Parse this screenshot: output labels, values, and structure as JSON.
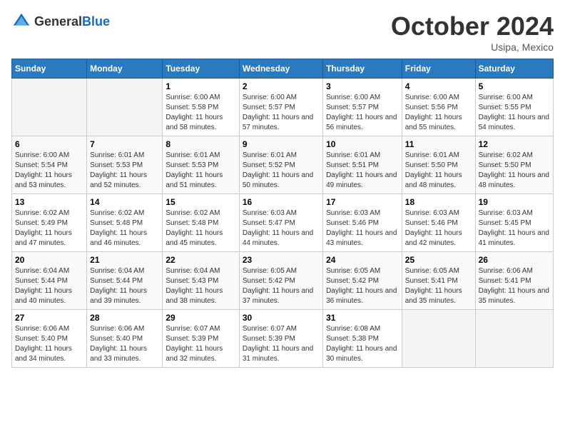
{
  "header": {
    "logo_general": "General",
    "logo_blue": "Blue",
    "month_title": "October 2024",
    "location": "Usipa, Mexico"
  },
  "days_of_week": [
    "Sunday",
    "Monday",
    "Tuesday",
    "Wednesday",
    "Thursday",
    "Friday",
    "Saturday"
  ],
  "weeks": [
    [
      {
        "day": "",
        "sunrise": "",
        "sunset": "",
        "daylight": ""
      },
      {
        "day": "",
        "sunrise": "",
        "sunset": "",
        "daylight": ""
      },
      {
        "day": "1",
        "sunrise": "Sunrise: 6:00 AM",
        "sunset": "Sunset: 5:58 PM",
        "daylight": "Daylight: 11 hours and 58 minutes."
      },
      {
        "day": "2",
        "sunrise": "Sunrise: 6:00 AM",
        "sunset": "Sunset: 5:57 PM",
        "daylight": "Daylight: 11 hours and 57 minutes."
      },
      {
        "day": "3",
        "sunrise": "Sunrise: 6:00 AM",
        "sunset": "Sunset: 5:57 PM",
        "daylight": "Daylight: 11 hours and 56 minutes."
      },
      {
        "day": "4",
        "sunrise": "Sunrise: 6:00 AM",
        "sunset": "Sunset: 5:56 PM",
        "daylight": "Daylight: 11 hours and 55 minutes."
      },
      {
        "day": "5",
        "sunrise": "Sunrise: 6:00 AM",
        "sunset": "Sunset: 5:55 PM",
        "daylight": "Daylight: 11 hours and 54 minutes."
      }
    ],
    [
      {
        "day": "6",
        "sunrise": "Sunrise: 6:00 AM",
        "sunset": "Sunset: 5:54 PM",
        "daylight": "Daylight: 11 hours and 53 minutes."
      },
      {
        "day": "7",
        "sunrise": "Sunrise: 6:01 AM",
        "sunset": "Sunset: 5:53 PM",
        "daylight": "Daylight: 11 hours and 52 minutes."
      },
      {
        "day": "8",
        "sunrise": "Sunrise: 6:01 AM",
        "sunset": "Sunset: 5:53 PM",
        "daylight": "Daylight: 11 hours and 51 minutes."
      },
      {
        "day": "9",
        "sunrise": "Sunrise: 6:01 AM",
        "sunset": "Sunset: 5:52 PM",
        "daylight": "Daylight: 11 hours and 50 minutes."
      },
      {
        "day": "10",
        "sunrise": "Sunrise: 6:01 AM",
        "sunset": "Sunset: 5:51 PM",
        "daylight": "Daylight: 11 hours and 49 minutes."
      },
      {
        "day": "11",
        "sunrise": "Sunrise: 6:01 AM",
        "sunset": "Sunset: 5:50 PM",
        "daylight": "Daylight: 11 hours and 48 minutes."
      },
      {
        "day": "12",
        "sunrise": "Sunrise: 6:02 AM",
        "sunset": "Sunset: 5:50 PM",
        "daylight": "Daylight: 11 hours and 48 minutes."
      }
    ],
    [
      {
        "day": "13",
        "sunrise": "Sunrise: 6:02 AM",
        "sunset": "Sunset: 5:49 PM",
        "daylight": "Daylight: 11 hours and 47 minutes."
      },
      {
        "day": "14",
        "sunrise": "Sunrise: 6:02 AM",
        "sunset": "Sunset: 5:48 PM",
        "daylight": "Daylight: 11 hours and 46 minutes."
      },
      {
        "day": "15",
        "sunrise": "Sunrise: 6:02 AM",
        "sunset": "Sunset: 5:48 PM",
        "daylight": "Daylight: 11 hours and 45 minutes."
      },
      {
        "day": "16",
        "sunrise": "Sunrise: 6:03 AM",
        "sunset": "Sunset: 5:47 PM",
        "daylight": "Daylight: 11 hours and 44 minutes."
      },
      {
        "day": "17",
        "sunrise": "Sunrise: 6:03 AM",
        "sunset": "Sunset: 5:46 PM",
        "daylight": "Daylight: 11 hours and 43 minutes."
      },
      {
        "day": "18",
        "sunrise": "Sunrise: 6:03 AM",
        "sunset": "Sunset: 5:46 PM",
        "daylight": "Daylight: 11 hours and 42 minutes."
      },
      {
        "day": "19",
        "sunrise": "Sunrise: 6:03 AM",
        "sunset": "Sunset: 5:45 PM",
        "daylight": "Daylight: 11 hours and 41 minutes."
      }
    ],
    [
      {
        "day": "20",
        "sunrise": "Sunrise: 6:04 AM",
        "sunset": "Sunset: 5:44 PM",
        "daylight": "Daylight: 11 hours and 40 minutes."
      },
      {
        "day": "21",
        "sunrise": "Sunrise: 6:04 AM",
        "sunset": "Sunset: 5:44 PM",
        "daylight": "Daylight: 11 hours and 39 minutes."
      },
      {
        "day": "22",
        "sunrise": "Sunrise: 6:04 AM",
        "sunset": "Sunset: 5:43 PM",
        "daylight": "Daylight: 11 hours and 38 minutes."
      },
      {
        "day": "23",
        "sunrise": "Sunrise: 6:05 AM",
        "sunset": "Sunset: 5:42 PM",
        "daylight": "Daylight: 11 hours and 37 minutes."
      },
      {
        "day": "24",
        "sunrise": "Sunrise: 6:05 AM",
        "sunset": "Sunset: 5:42 PM",
        "daylight": "Daylight: 11 hours and 36 minutes."
      },
      {
        "day": "25",
        "sunrise": "Sunrise: 6:05 AM",
        "sunset": "Sunset: 5:41 PM",
        "daylight": "Daylight: 11 hours and 35 minutes."
      },
      {
        "day": "26",
        "sunrise": "Sunrise: 6:06 AM",
        "sunset": "Sunset: 5:41 PM",
        "daylight": "Daylight: 11 hours and 35 minutes."
      }
    ],
    [
      {
        "day": "27",
        "sunrise": "Sunrise: 6:06 AM",
        "sunset": "Sunset: 5:40 PM",
        "daylight": "Daylight: 11 hours and 34 minutes."
      },
      {
        "day": "28",
        "sunrise": "Sunrise: 6:06 AM",
        "sunset": "Sunset: 5:40 PM",
        "daylight": "Daylight: 11 hours and 33 minutes."
      },
      {
        "day": "29",
        "sunrise": "Sunrise: 6:07 AM",
        "sunset": "Sunset: 5:39 PM",
        "daylight": "Daylight: 11 hours and 32 minutes."
      },
      {
        "day": "30",
        "sunrise": "Sunrise: 6:07 AM",
        "sunset": "Sunset: 5:39 PM",
        "daylight": "Daylight: 11 hours and 31 minutes."
      },
      {
        "day": "31",
        "sunrise": "Sunrise: 6:08 AM",
        "sunset": "Sunset: 5:38 PM",
        "daylight": "Daylight: 11 hours and 30 minutes."
      },
      {
        "day": "",
        "sunrise": "",
        "sunset": "",
        "daylight": ""
      },
      {
        "day": "",
        "sunrise": "",
        "sunset": "",
        "daylight": ""
      }
    ]
  ]
}
